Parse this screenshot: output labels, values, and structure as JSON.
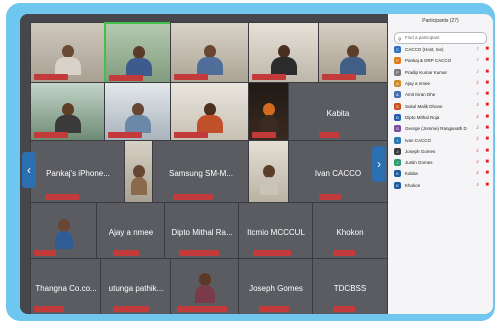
{
  "sidebar": {
    "title": "Participants (27)",
    "search_placeholder": "Find a participant",
    "participants": [
      {
        "name": "CACCO (Host, me)",
        "color": "#2e6fc1",
        "initials": "C",
        "mic": "on"
      },
      {
        "name": "Pankaj & DRP CACCO",
        "color": "#e07a16",
        "initials": "P",
        "mic": "on"
      },
      {
        "name": "Pradip Kumar Kumar",
        "color": "#7a7a7a",
        "initials": "P",
        "mic": "on"
      },
      {
        "name": "Ajay a nmee",
        "color": "#d08a2a",
        "initials": "A",
        "mic": "off"
      },
      {
        "name": "Amit Kiran Dhe",
        "color": "#4a6fb0",
        "initials": "A",
        "mic": "on"
      },
      {
        "name": "Sukul Malik Dhone",
        "color": "#c95020",
        "initials": "S",
        "mic": "off"
      },
      {
        "name": "Dipto Mithal Roja",
        "color": "#1f5fae",
        "initials": "D",
        "mic": "off"
      },
      {
        "name": "George (Jomme) Ranganath Dutta",
        "color": "#7a4aa0",
        "initials": "G",
        "mic": "off"
      },
      {
        "name": "Ivan CACCO",
        "color": "#2a7ab0",
        "initials": "I",
        "mic": "off"
      },
      {
        "name": "Joseph Gomes",
        "color": "#3b3b3b",
        "initials": "J",
        "mic": "off"
      },
      {
        "name": "Justin Gomes",
        "color": "#2c9c6a",
        "initials": "J",
        "mic": "off"
      },
      {
        "name": "Kabita",
        "color": "#1d5d9f",
        "initials": "K",
        "mic": "off"
      },
      {
        "name": "Khokon",
        "color": "#1d5d9f",
        "initials": "K",
        "mic": "off"
      }
    ]
  },
  "tiles": {
    "samsung": "Samsung SM-M...",
    "ivan": "Ivan CACCO",
    "pankaj_iphone": "Pankaj's iPhone...",
    "kabita": "Kabita",
    "ajay": "Ajay a nmee",
    "dipto": "Dipto Mithal Ra...",
    "itcmio": "Itcmio MCCCUL",
    "khokon": "Khokon",
    "thangna": "Thangna Co.co...",
    "utunga": "utunga pathik...",
    "joseph": "Joseph Gomes",
    "tdcbss": "TDCBSS"
  },
  "nav": {
    "prev": "‹",
    "next": "›"
  }
}
